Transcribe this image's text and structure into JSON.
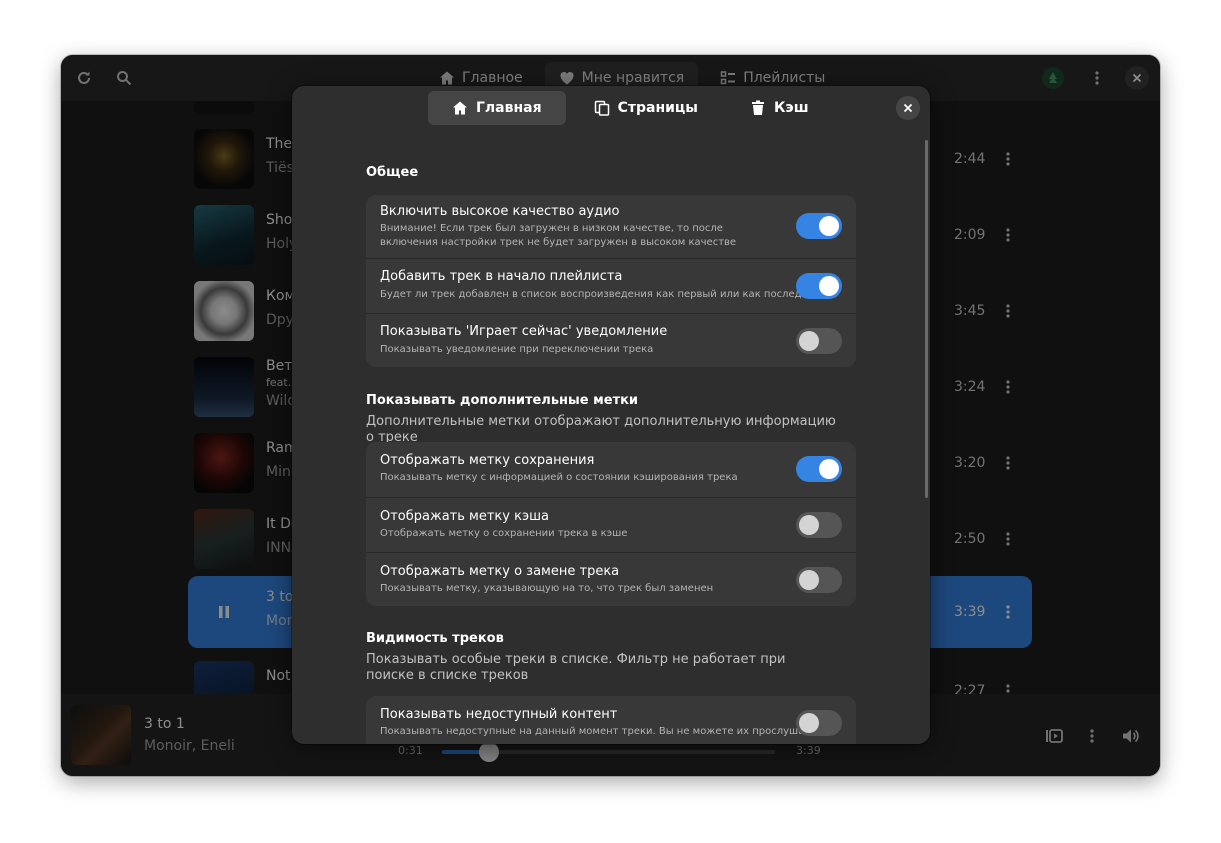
{
  "header": {
    "refresh_icon": "refresh-icon",
    "search_icon": "search-icon",
    "tabs": [
      {
        "label": "Главное",
        "icon": "home-icon"
      },
      {
        "label": "Мне нравится",
        "icon": "heart-icon"
      },
      {
        "label": "Плейлисты",
        "icon": "list-icon"
      }
    ],
    "active_tab": 1
  },
  "tracks": [
    {
      "title": "The",
      "artist": "Tiëst",
      "duration": "2:44"
    },
    {
      "title": "Shot",
      "artist": "Holy",
      "duration": "2:09"
    },
    {
      "title": "Ком",
      "artist": "Dpyr",
      "duration": "3:45"
    },
    {
      "title": "Вети",
      "feat": "feat.",
      "artist": "Wild",
      "duration": "3:24"
    },
    {
      "title": "Ram",
      "artist": "Mine",
      "duration": "3:20"
    },
    {
      "title": "It Do",
      "artist": "INNA",
      "duration": "2:50"
    },
    {
      "title": "3 to",
      "artist": "Mon",
      "duration": "3:39"
    },
    {
      "title": "Not",
      "artist": "",
      "duration": "2:27"
    }
  ],
  "player": {
    "title": "3 to 1",
    "artist": "Monoir, Eneli",
    "elapsed": "0:31",
    "total": "3:39",
    "progress": 0.14
  },
  "dialog": {
    "tabs": [
      {
        "label": "Главная",
        "icon": "home-icon"
      },
      {
        "label": "Страницы",
        "icon": "pages-icon"
      },
      {
        "label": "Кэш",
        "icon": "trash-icon"
      }
    ],
    "active_tab": 0,
    "sections": [
      {
        "title": "Общее",
        "rows": [
          {
            "title": "Включить высокое качество аудио",
            "subtitle": "Внимание! Если трек был загружен в низком качестве, то после включения настройки трек не будет загружен в высоком качестве",
            "on": true
          },
          {
            "title": "Добавить трек в начало плейлиста",
            "subtitle": "Будет ли трек добавлен в список воспроизведения как первый или как последний",
            "on": true
          },
          {
            "title": "Показывать 'Играет сейчас' уведомление",
            "subtitle": "Показывать уведомление при переключении трека",
            "on": false
          }
        ]
      },
      {
        "title": "Показывать дополнительные метки",
        "description": "Дополнительные метки отображают дополнительную информацию о треке",
        "rows": [
          {
            "title": "Отображать метку сохранения",
            "subtitle": "Показывать метку с информацией о состоянии кэширования трека",
            "on": true
          },
          {
            "title": "Отображать метку кэша",
            "subtitle": "Отображать метку о сохранении трека в кэше",
            "on": false
          },
          {
            "title": "Отображать метку о замене трека",
            "subtitle": "Показывать метку, указывающую на то, что трек был заменен",
            "on": false
          }
        ]
      },
      {
        "title": "Видимость треков",
        "description": "Показывать особые треки в списке. Фильтр не работает при поиске в списке треков",
        "rows": [
          {
            "title": "Показывать недоступный контент",
            "subtitle": "Показывать недоступные на данный момент треки. Вы не можете их прослушать",
            "on": false
          }
        ]
      }
    ]
  }
}
